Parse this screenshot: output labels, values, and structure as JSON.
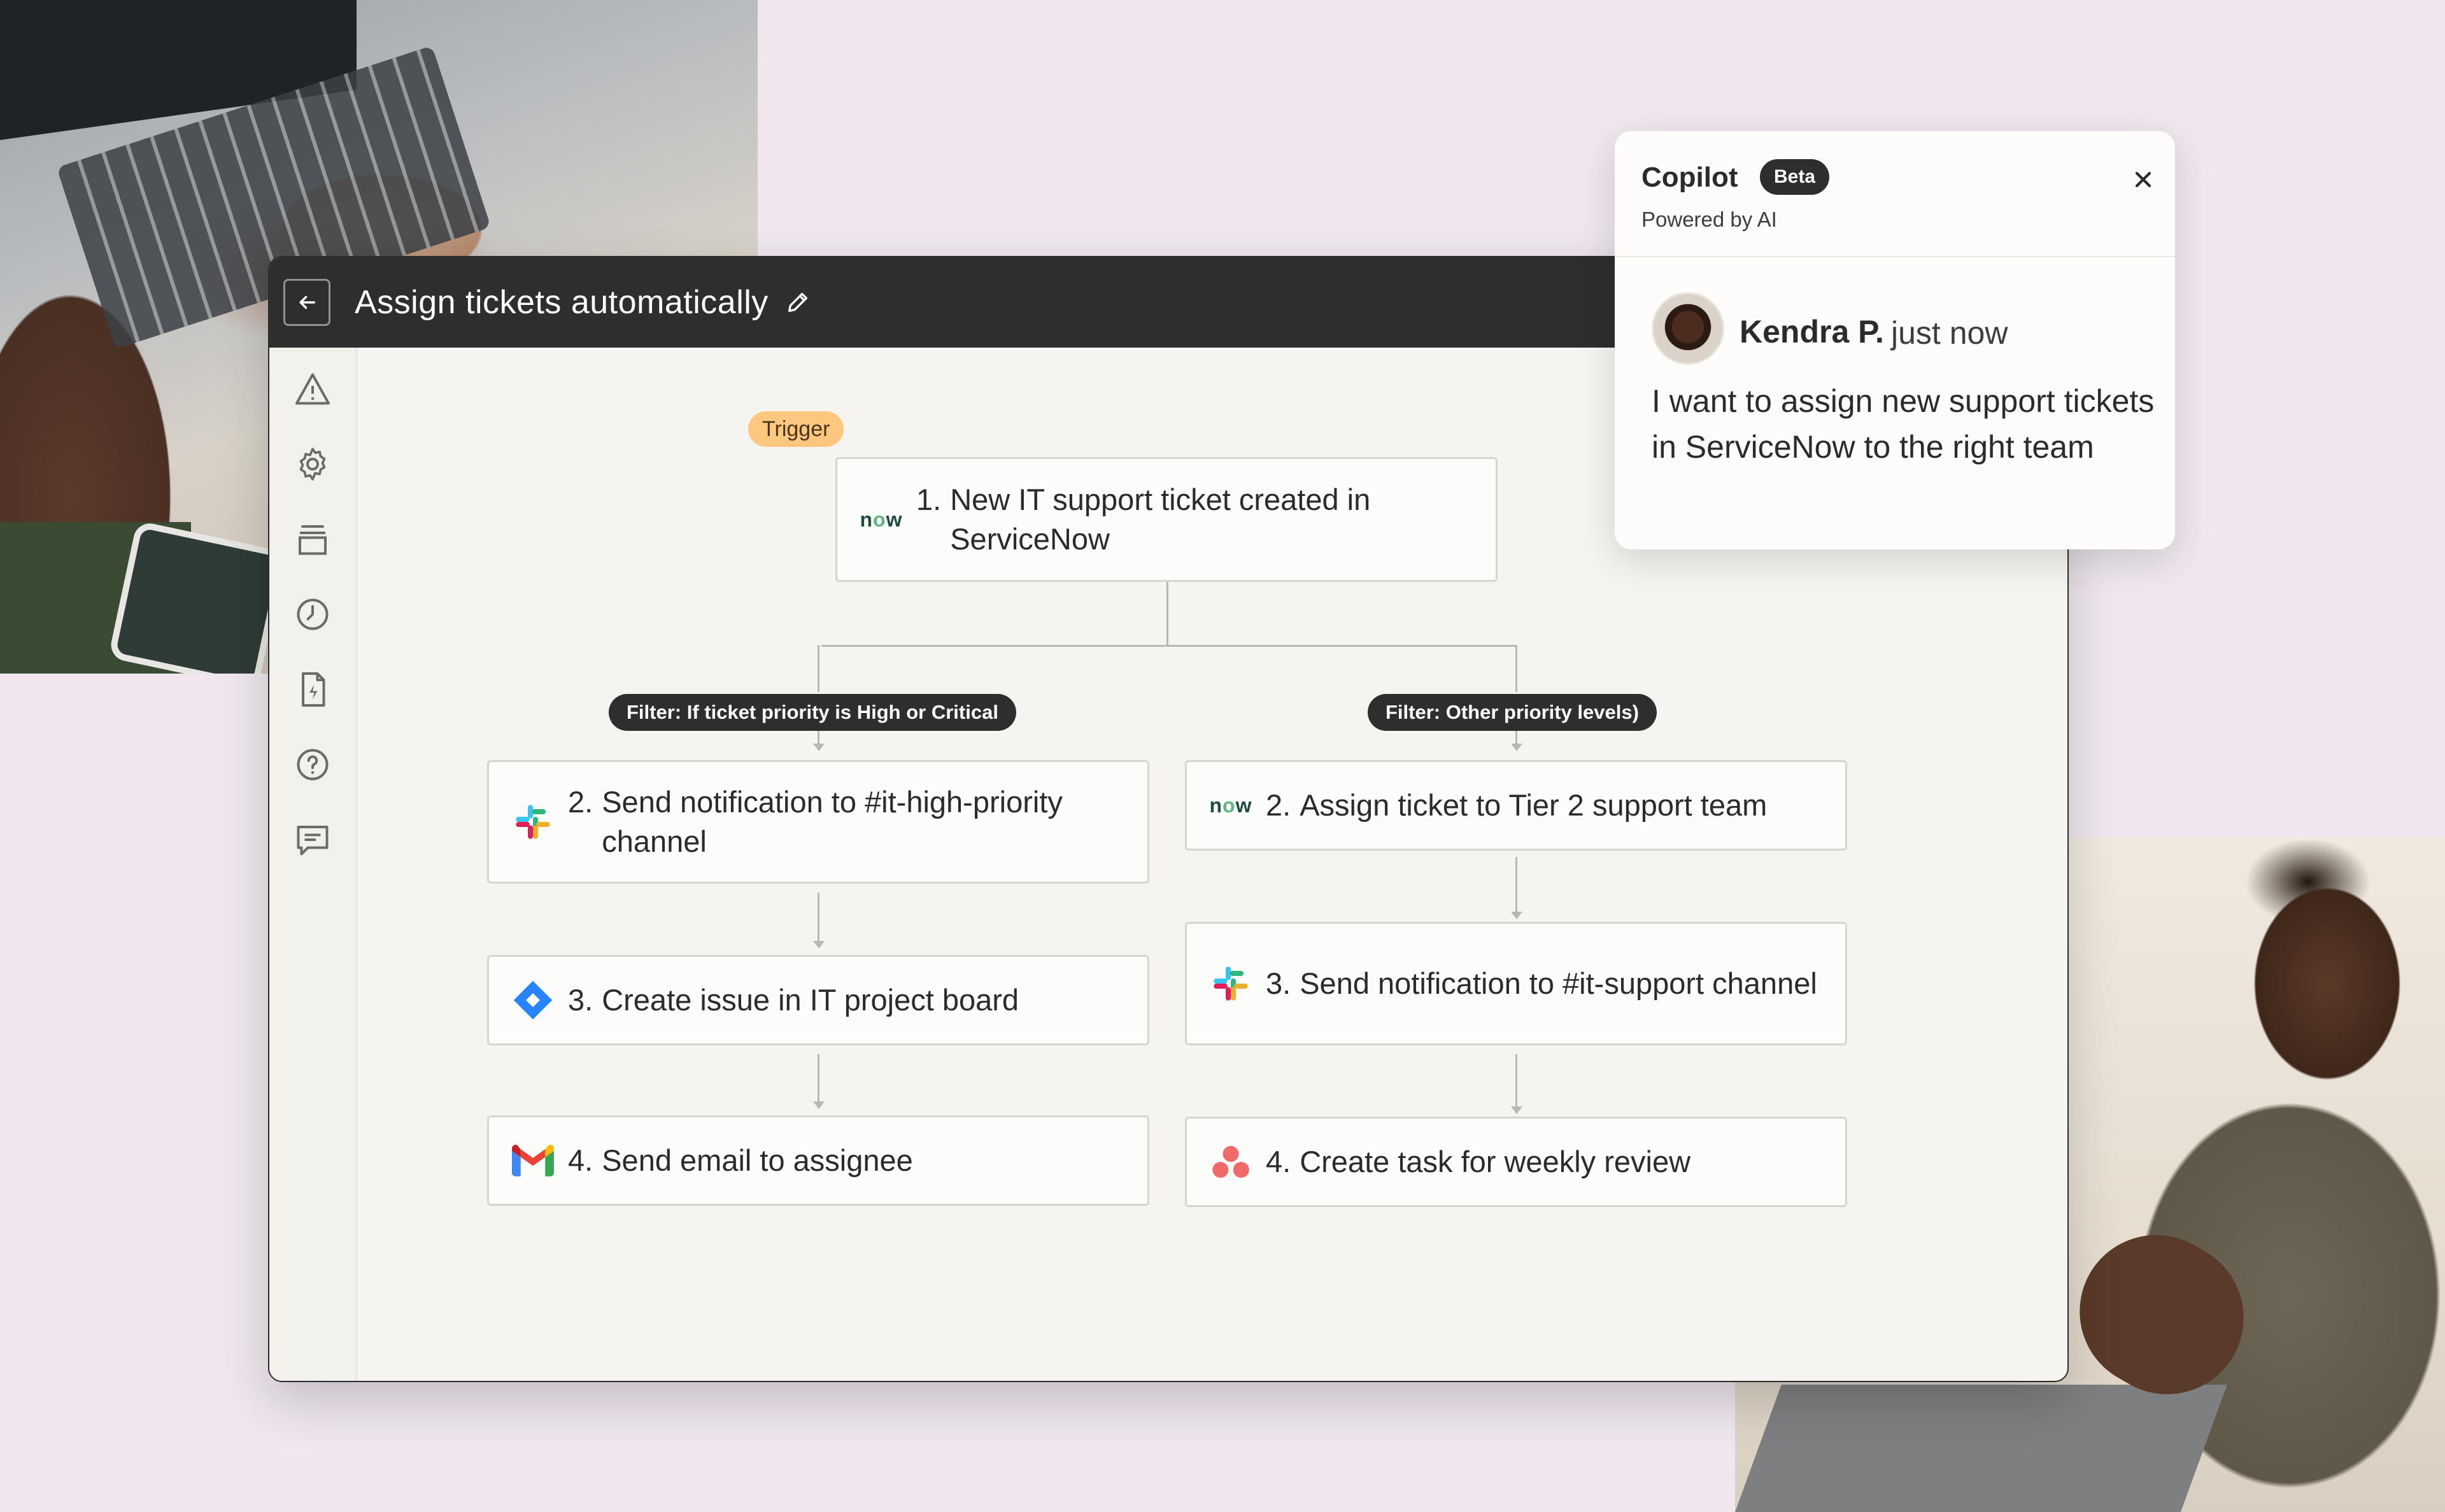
{
  "window": {
    "title": "Assign tickets automatically"
  },
  "sidebar": {
    "items": [
      {
        "icon": "warning-icon"
      },
      {
        "icon": "gear-icon"
      },
      {
        "icon": "layers-icon"
      },
      {
        "icon": "clock-icon"
      },
      {
        "icon": "zap-file-icon"
      },
      {
        "icon": "help-icon"
      },
      {
        "icon": "comment-icon"
      }
    ]
  },
  "workflow": {
    "trigger_label": "Trigger",
    "trigger": {
      "number": "1.",
      "text": "New IT support ticket created in ServiceNow",
      "app": "ServiceNow"
    },
    "branches": [
      {
        "filter": "Filter: If ticket priority is High or Critical",
        "steps": [
          {
            "number": "2.",
            "text": "Send notification to #it-high-priority channel",
            "app": "Slack"
          },
          {
            "number": "3.",
            "text": "Create issue in IT project board",
            "app": "Jira"
          },
          {
            "number": "4.",
            "text": "Send email to assignee",
            "app": "Gmail"
          }
        ]
      },
      {
        "filter": "Filter: Other priority levels)",
        "steps": [
          {
            "number": "2.",
            "text": "Assign ticket to Tier 2 support team",
            "app": "ServiceNow"
          },
          {
            "number": "3.",
            "text": "Send notification to #it-support channel",
            "app": "Slack"
          },
          {
            "number": "4.",
            "text": "Create task for weekly review",
            "app": "Asana"
          }
        ]
      }
    ],
    "now_logo": {
      "n": "n",
      "o": "o",
      "w": "w"
    }
  },
  "copilot": {
    "title": "Copilot",
    "badge": "Beta",
    "subtitle": "Powered by AI",
    "message": {
      "author": "Kendra P.",
      "time": "just now",
      "text": "I want to assign new support tickets in ServiceNow to the right team"
    }
  },
  "colors": {
    "topbar": "#2d2e2e",
    "trigger_badge": "#fcc77f",
    "background": "#efe6ee",
    "canvas": "#f5f4f0"
  }
}
